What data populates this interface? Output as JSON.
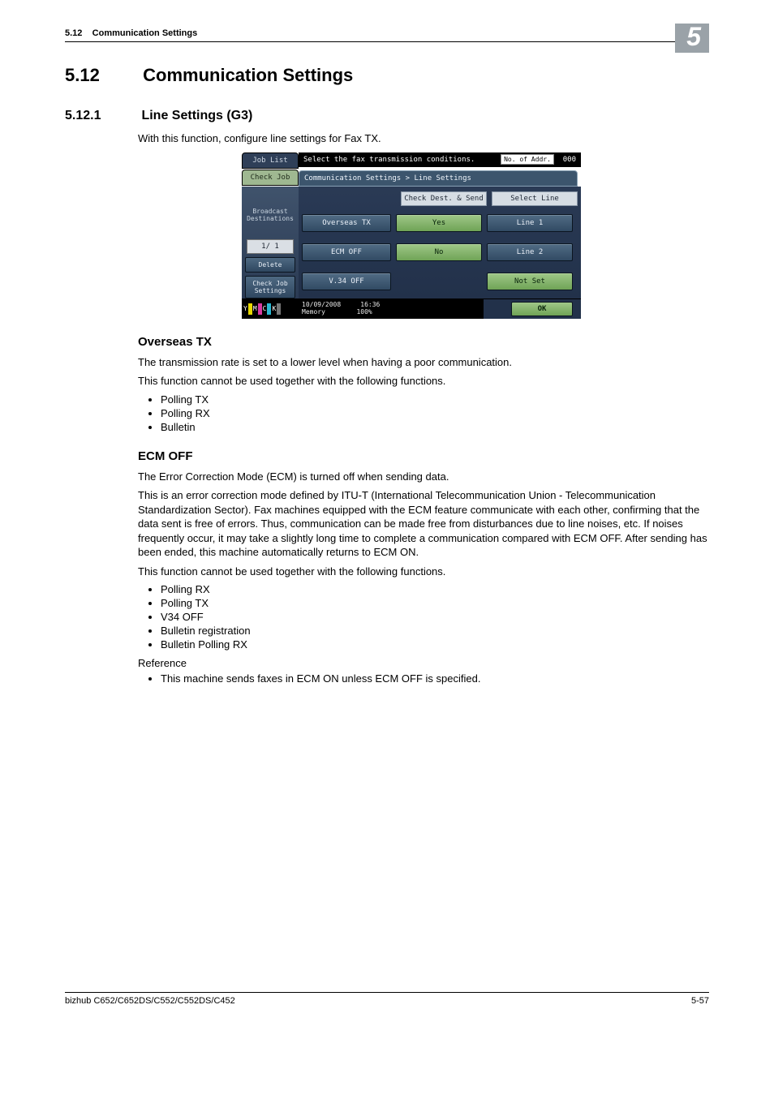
{
  "running_header": {
    "section_num": "5.12",
    "section_title": "Communication Settings",
    "chapter_num": "5"
  },
  "h1": {
    "num": "5.12",
    "title": "Communication Settings"
  },
  "h2": {
    "num": "5.12.1",
    "title": "Line Settings (G3)"
  },
  "intro": "With this function, configure line settings for Fax TX.",
  "screen": {
    "job_list": "Job List",
    "check_job": "Check Job",
    "title": "Select the fax transmission conditions.",
    "addr_label": "No. of Addr.",
    "addr_count": "000",
    "breadcrumb": "Communication Settings > Line Settings",
    "col_check": "Check Dest. & Send",
    "col_select": "Select Line",
    "r1": {
      "a": "Overseas TX",
      "b": "Yes",
      "c": "Line 1"
    },
    "r2": {
      "a": "ECM OFF",
      "b": "No",
      "c": "Line 2"
    },
    "r3": {
      "a": "V.34 OFF",
      "c": "Not Set"
    },
    "left": {
      "broadcast": "Broadcast Destinations",
      "pager": "1/   1",
      "delete": "Delete",
      "check": "Check Job Settings"
    },
    "status": {
      "date": "10/09/2008",
      "time": "16:36",
      "mem_label": "Memory",
      "mem_val": "100%"
    },
    "ok": "OK",
    "toner": {
      "y": "Y",
      "m": "M",
      "c": "C",
      "k": "K"
    }
  },
  "overseas": {
    "heading": "Overseas TX",
    "p1": "The transmission rate is set to a lower level when having a poor communication.",
    "p2": "This function cannot be used together with the following functions.",
    "items": [
      "Polling TX",
      "Polling RX",
      "Bulletin"
    ]
  },
  "ecm": {
    "heading": "ECM OFF",
    "p1": "The Error Correction Mode (ECM) is turned off when sending data.",
    "p2": "This is an error correction mode defined by ITU-T (International Telecommunication Union - Telecommunication Standardization Sector). Fax machines equipped with the ECM feature communicate with each other, confirming that the data sent is free of errors. Thus, communication can be made free from disturbances due to line noises, etc. If noises frequently occur, it may take a slightly long time to complete a communication compared with ECM OFF. After sending has been ended, this machine automatically returns to ECM ON.",
    "p3": "This function cannot be used together with the following functions.",
    "items": [
      "Polling RX",
      "Polling TX",
      "V34 OFF",
      "Bulletin registration",
      "Bulletin Polling RX"
    ],
    "ref_label": "Reference",
    "ref_item": "This machine sends faxes in ECM ON unless ECM OFF is specified."
  },
  "footer": {
    "left": "bizhub C652/C652DS/C552/C552DS/C452",
    "right": "5-57"
  }
}
